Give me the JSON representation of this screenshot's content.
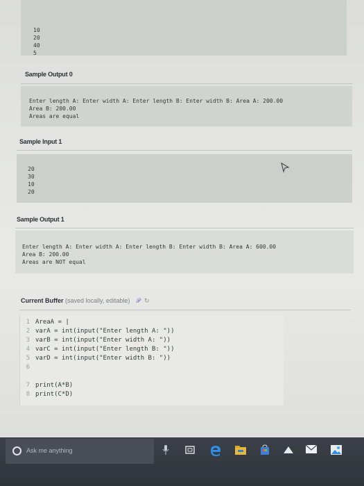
{
  "top_input": {
    "lines": [
      "10",
      "20",
      "40",
      "5"
    ]
  },
  "sample_output_0": {
    "heading": "Sample Output 0",
    "lines": [
      "Enter length A: Enter width A: Enter length B: Enter width B: Area A: 200.00",
      "Area B: 200.00",
      "Areas are equal"
    ]
  },
  "sample_input_1": {
    "heading": "Sample Input 1",
    "lines": [
      "20",
      "30",
      "10",
      "20"
    ]
  },
  "sample_output_1": {
    "heading": "Sample Output 1",
    "lines": [
      "Enter length A: Enter width A: Enter length B: Enter width B: Area A: 600.00",
      "Area B: 200.00",
      "Areas are NOT equal"
    ]
  },
  "buffer": {
    "title": "Current Buffer",
    "subtitle": "(saved locally, editable)",
    "lines": [
      {
        "n": "1",
        "code": "AreaA = |"
      },
      {
        "n": "2",
        "code": "varA = int(input(\"Enter length A: \"))"
      },
      {
        "n": "3",
        "code": "varB = int(input(\"Enter width A: \"))"
      },
      {
        "n": "4",
        "code": "varC = int(input(\"Enter length B: \"))"
      },
      {
        "n": "5",
        "code": "varD = int(input(\"Enter width B: \"))"
      },
      {
        "n": "6",
        "code": ""
      },
      {
        "n": "7",
        "code": "print(A*B)"
      },
      {
        "n": "8",
        "code": "print(C*D)"
      }
    ]
  },
  "taskbar": {
    "search_placeholder": "Ask me anything",
    "icons": [
      "microphone-icon",
      "task-view-icon",
      "edge-icon",
      "file-explorer-icon",
      "store-icon",
      "app-icon",
      "mail-icon",
      "photos-icon"
    ]
  }
}
